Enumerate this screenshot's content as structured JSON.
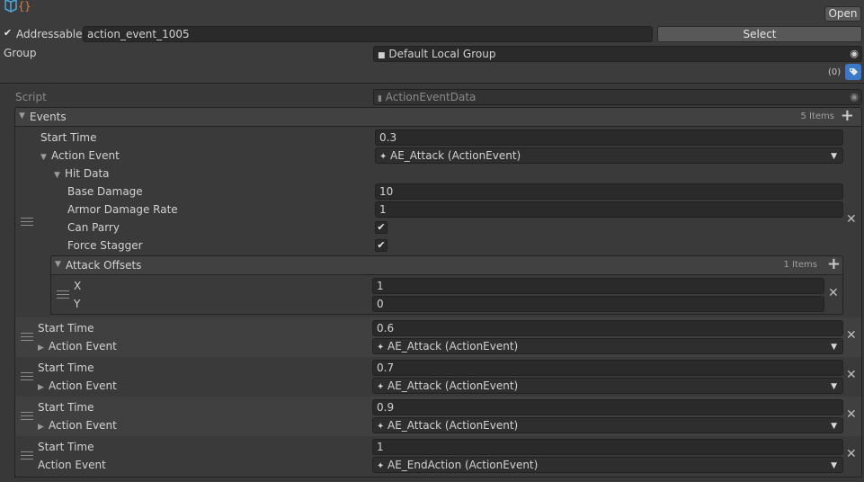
{
  "header": {
    "open_label": "Open",
    "addressable_label": "Addressable",
    "addressable_checked": true,
    "address_value": "action_event_1005",
    "select_label": "Select",
    "group_label": "Group",
    "group_value": "Default Local Group",
    "labels_count": "(0)"
  },
  "script": {
    "label": "Script",
    "value": "ActionEventData"
  },
  "events": {
    "label": "Events",
    "count": "5 Items",
    "items": [
      {
        "start_time_label": "Start Time",
        "start_time": "0.3",
        "action_event_label": "Action Event",
        "action_event_value": "AE_Attack (ActionEvent)",
        "hit_data_label": "Hit Data",
        "base_damage_label": "Base Damage",
        "base_damage": "10",
        "armor_damage_rate_label": "Armor Damage Rate",
        "armor_damage_rate": "1",
        "can_parry_label": "Can Parry",
        "can_parry": true,
        "force_stagger_label": "Force Stagger",
        "force_stagger": true,
        "attack_offsets_label": "Attack Offsets",
        "attack_offsets_count": "1 Items",
        "x_label": "X",
        "x_value": "1",
        "y_label": "Y",
        "y_value": "0"
      },
      {
        "start_time_label": "Start Time",
        "start_time": "0.6",
        "action_event_label": "Action Event",
        "action_event_value": "AE_Attack (ActionEvent)"
      },
      {
        "start_time_label": "Start Time",
        "start_time": "0.7",
        "action_event_label": "Action Event",
        "action_event_value": "AE_Attack (ActionEvent)"
      },
      {
        "start_time_label": "Start Time",
        "start_time": "0.9",
        "action_event_label": "Action Event",
        "action_event_value": "AE_Attack (ActionEvent)"
      },
      {
        "start_time_label": "Start Time",
        "start_time": "1",
        "action_event_label": "Action Event",
        "action_event_value": "AE_EndAction (ActionEvent)"
      }
    ]
  },
  "icons": {
    "check": "✔",
    "triangle_down": "▼",
    "triangle_right": "▶",
    "close": "✕",
    "plus": "+",
    "folder": "folder-icon",
    "target": "target-icon",
    "tag": "tag-icon",
    "script": "script-icon",
    "object": "object-icon"
  },
  "colors": {
    "background": "#383838",
    "field": "#2a2a2a",
    "button": "#585858",
    "accent_tag": "#3a78c9",
    "logo_blue": "#4aa3d8",
    "logo_orange": "#e07a3a"
  }
}
